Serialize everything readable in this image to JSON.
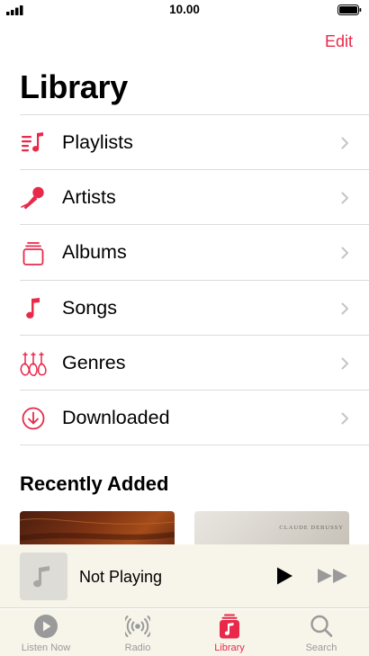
{
  "status_bar": {
    "time": "10.00"
  },
  "header": {
    "edit_label": "Edit",
    "title": "Library"
  },
  "library_items": [
    {
      "label": "Playlists",
      "icon": "playlists-icon"
    },
    {
      "label": "Artists",
      "icon": "microphone-icon"
    },
    {
      "label": "Albums",
      "icon": "album-stack-icon"
    },
    {
      "label": "Songs",
      "icon": "music-note-icon"
    },
    {
      "label": "Genres",
      "icon": "guitars-icon"
    },
    {
      "label": "Downloaded",
      "icon": "download-circle-icon"
    }
  ],
  "recently_added": {
    "title": "Recently Added",
    "albums": [
      {
        "cover_text": ""
      },
      {
        "cover_text": "CLAUDE DEBUSSY"
      }
    ]
  },
  "now_playing": {
    "title": "Not Playing"
  },
  "tabs": [
    {
      "label": "Listen Now",
      "icon": "play-circle-icon",
      "active": false
    },
    {
      "label": "Radio",
      "icon": "radio-waves-icon",
      "active": false
    },
    {
      "label": "Library",
      "icon": "library-icon",
      "active": true
    },
    {
      "label": "Search",
      "icon": "search-icon",
      "active": false
    }
  ],
  "colors": {
    "accent": "#e8294a",
    "chevron": "#c4c4c6",
    "inactive_tab": "#9a9a9a",
    "player_bg": "#f7f4ea"
  }
}
